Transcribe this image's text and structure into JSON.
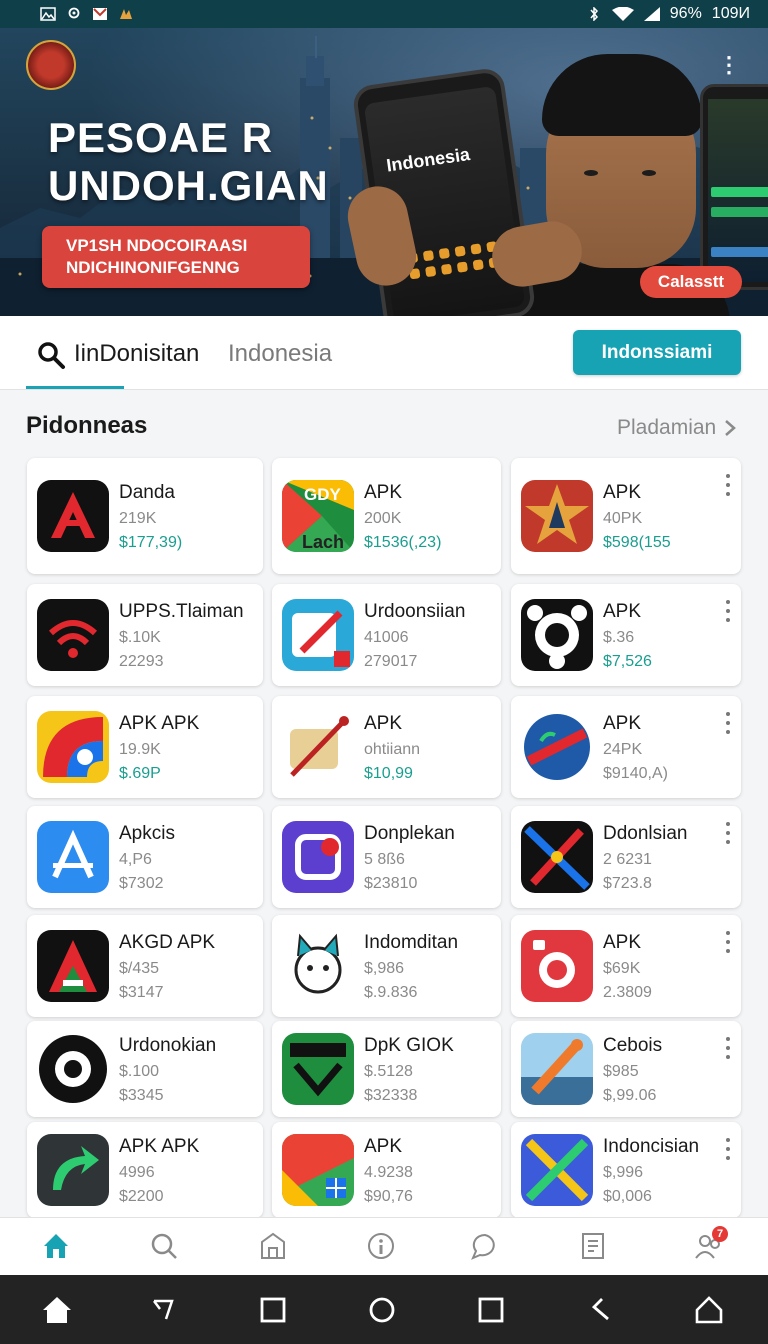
{
  "status_bar": {
    "battery": "96%",
    "time": "109И",
    "left_icons": [
      "gallery-icon",
      "location-icon",
      "mail-icon",
      "app-icon"
    ],
    "right_icons": [
      "bluetooth-icon",
      "wifi-icon",
      "signal-icon"
    ]
  },
  "banner": {
    "title_line1": "PESOAE R",
    "title_line2": "UNDOH.GIAN",
    "subtitle_line1": "VP1SH NDOCOIRAASI",
    "subtitle_line2": "NDICHINONIFGENNG",
    "phone_screen_text": "Indonesia",
    "cta_label": "Calasstt"
  },
  "search": {
    "query": "IinDonisitan",
    "hint": "Indonesia",
    "button_label": "Indonssiami"
  },
  "section": {
    "title": "Pidonneas",
    "link_label": "Pladamian"
  },
  "apps": [
    {
      "name": "Danda",
      "meta": "219K",
      "price": "$177,39)",
      "price_color": "#1a9e8f",
      "icon": "a-logo-icon"
    },
    {
      "name": "APK",
      "meta": "200K",
      "price": "$1536(,23)",
      "price_color": "#1a9e8f",
      "icon": "gdy-lach-icon"
    },
    {
      "name": "APK",
      "meta": "40PK",
      "price": "$598(155",
      "price_color": "#1a9e8f",
      "icon": "star-emblem-icon"
    },
    {
      "name": "UPPS.Tlaiman",
      "meta": "$.10K",
      "price": "22293",
      "price_color": "#8a8a8a",
      "icon": "wifi-swirl-icon"
    },
    {
      "name": "Urdoonsiian",
      "meta": "41006",
      "price": "279017",
      "price_color": "#8a8a8a",
      "icon": "pen-card-icon"
    },
    {
      "name": "APK",
      "meta": "$.36",
      "price": "$7,526",
      "price_color": "#1a9e8f",
      "icon": "gear-ring-icon"
    },
    {
      "name": "APK APK",
      "meta": "19.9K",
      "price": "$.69P",
      "price_color": "#1a9e8f",
      "icon": "rainbow-swirl-icon"
    },
    {
      "name": "APK",
      "meta": "ohtiiann",
      "price": "$10,99",
      "price_color": "#1a9e8f",
      "icon": "scroll-quill-icon"
    },
    {
      "name": "APK",
      "meta": "24PK",
      "price": "$9140,A)",
      "price_color": "#8a8a8a",
      "icon": "globe-emblem-icon"
    },
    {
      "name": "Apkcis",
      "meta": "4,P6",
      "price": "$7302",
      "price_color": "#8a8a8a",
      "icon": "app-store-a-icon"
    },
    {
      "name": "Donplekan",
      "meta": "5 8ß6",
      "price": "$23810",
      "price_color": "#8a8a8a",
      "icon": "square-burst-icon"
    },
    {
      "name": "Ddonlsian",
      "meta": "2 6231",
      "price": "$723.8",
      "price_color": "#8a8a8a",
      "icon": "crossed-tools-icon"
    },
    {
      "name": "AKGD APK",
      "meta": "$/435",
      "price": "$3147",
      "price_color": "#8a8a8a",
      "icon": "tricolor-a-icon"
    },
    {
      "name": "Indomditan",
      "meta": "$,986",
      "price": "$.9.836",
      "price_color": "#8a8a8a",
      "icon": "cat-mascot-icon"
    },
    {
      "name": "APK",
      "meta": "$69K",
      "price": "2.3809",
      "price_color": "#8a8a8a",
      "icon": "camera-ring-icon"
    },
    {
      "name": "Urdonokian",
      "meta": "$.100",
      "price": "$3345",
      "price_color": "#8a8a8a",
      "icon": "gear-badge-icon"
    },
    {
      "name": "DpK GIOK",
      "meta": "$.5128",
      "price": "$32338",
      "price_color": "#8a8a8a",
      "icon": "green-check-icon"
    },
    {
      "name": "Cebois",
      "meta": "$985",
      "price": "$,99.06",
      "price_color": "#8a8a8a",
      "icon": "beach-pencil-icon"
    },
    {
      "name": "APK APK",
      "meta": "4996",
      "price": "$2200",
      "price_color": "#8a8a8a",
      "icon": "green-arrow-icon"
    },
    {
      "name": "APK",
      "meta": "4.9238",
      "price": "$90,76",
      "price_color": "#8a8a8a",
      "icon": "maps-pin-icon"
    },
    {
      "name": "Indoncisian",
      "meta": "$,996",
      "price": "$0,006",
      "price_color": "#8a8a8a",
      "icon": "crossed-pencil-icon"
    }
  ],
  "bottom_nav": {
    "badge": "7",
    "items": [
      "home-icon",
      "search-icon",
      "store-icon",
      "info-icon",
      "chat-icon",
      "document-icon",
      "people-icon"
    ]
  },
  "system_nav": [
    "home-icon",
    "back-icon",
    "recents-icon",
    "circle-home-icon",
    "square-icon",
    "back-alt-icon",
    "house-outline-icon"
  ]
}
